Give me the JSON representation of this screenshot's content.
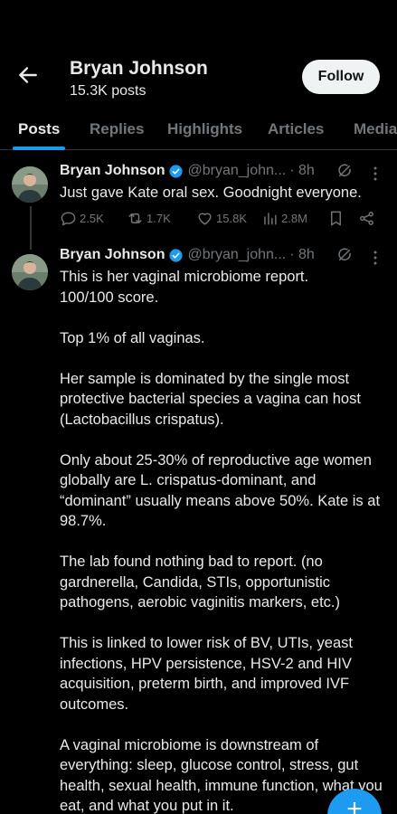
{
  "header": {
    "title": "Bryan Johnson",
    "post_count": "15.3K posts",
    "follow_label": "Follow"
  },
  "tabs": [
    {
      "label": "Posts",
      "active": true
    },
    {
      "label": "Replies",
      "active": false
    },
    {
      "label": "Highlights",
      "active": false
    },
    {
      "label": "Articles",
      "active": false
    },
    {
      "label": "Media",
      "active": false
    }
  ],
  "posts": [
    {
      "author": "Bryan Johnson",
      "handle": "@bryan_john...",
      "time": "· 8h",
      "text": "Just gave Kate oral sex. Goodnight everyone.",
      "replies": "2.5K",
      "reposts": "1.7K",
      "likes": "15.8K",
      "views": "2.8M"
    },
    {
      "author": "Bryan Johnson",
      "handle": "@bryan_john...",
      "time": "· 8h",
      "text": "This is her vaginal microbiome report.\n100/100 score.\n\nTop 1% of all vaginas.\n\nHer sample is dominated by the single most protective bacterial species a vagina can host (Lactobacillus crispatus).\n\nOnly about 25-30% of reproductive age women globally are L. crispatus-dominant, and “dominant” usually means above 50%. Kate is at 98.7%.\n\nThe lab found nothing bad to report. (no gardnerella, Candida, STIs, opportunistic pathogens, aerobic vaginitis markers, etc.)\n\nThis is linked to lower risk of BV, UTIs, yeast infections, HPV persistence, HSV-2 and HIV acquisition, preterm birth, and improved IVF outcomes.\n\nA vaginal microbiome is downstream of everything: sleep, glucose control, stress, gut health, sexual health, immune function, what you eat, and what you put in it."
    }
  ],
  "icons": {
    "back": "arrow-left-icon",
    "verified": "verified-badge-icon",
    "grok": "grok-icon",
    "more": "more-dots-icon",
    "reply": "reply-icon",
    "repost": "repost-icon",
    "like": "heart-icon",
    "views": "views-icon",
    "bookmark": "bookmark-icon",
    "share": "share-icon",
    "compose": "plus-icon"
  },
  "colors": {
    "background": "#000000",
    "accent": "#1d9bf0",
    "text": "#e7e9ea",
    "muted": "#71767b"
  }
}
